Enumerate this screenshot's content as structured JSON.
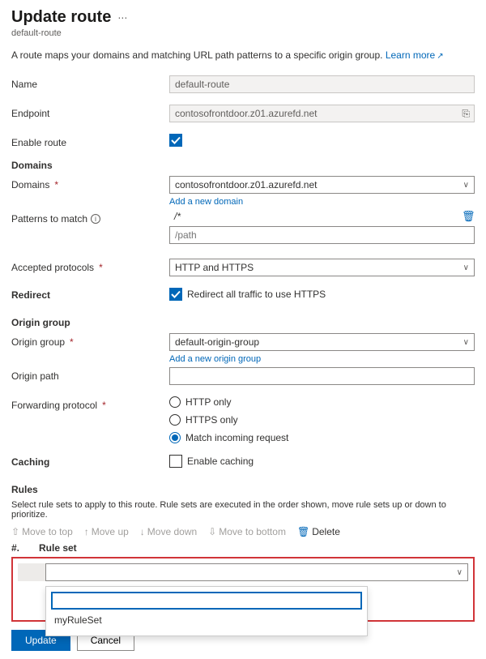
{
  "header": {
    "title": "Update route",
    "subtitle": "default-route",
    "description": "A route maps your domains and matching URL path patterns to a specific origin group.",
    "learn_more": "Learn more"
  },
  "fields": {
    "name": {
      "label": "Name",
      "value": "default-route"
    },
    "endpoint": {
      "label": "Endpoint",
      "value": "contosofrontdoor.z01.azurefd.net"
    },
    "enable_route": {
      "label": "Enable route",
      "checked": true
    }
  },
  "domains": {
    "section": "Domains",
    "domains_label": "Domains",
    "domains_value": "contosofrontdoor.z01.azurefd.net",
    "add_link": "Add a new domain",
    "patterns_label": "Patterns to match",
    "pattern_static": "/*",
    "pattern_input_placeholder": "/path",
    "accepted_label": "Accepted protocols",
    "accepted_value": "HTTP and HTTPS"
  },
  "redirect": {
    "section": "Redirect",
    "redirect_label": "Redirect all traffic to use HTTPS",
    "checked": true
  },
  "origin": {
    "section": "Origin group",
    "group_label": "Origin group",
    "group_value": "default-origin-group",
    "add_link": "Add a new origin group",
    "path_label": "Origin path",
    "path_value": "",
    "fwd_label": "Forwarding protocol",
    "fwd_options": [
      "HTTP only",
      "HTTPS only",
      "Match incoming request"
    ],
    "fwd_selected": 2
  },
  "caching": {
    "section": "Caching",
    "enable_label": "Enable caching",
    "checked": false
  },
  "rules": {
    "section": "Rules",
    "desc": "Select rule sets to apply to this route. Rule sets are executed in the order shown, move rule sets up or down to prioritize.",
    "toolbar": {
      "top": "Move to top",
      "up": "Move up",
      "down": "Move down",
      "bottom": "Move to bottom",
      "delete": "Delete"
    },
    "col_num": "#.",
    "col_ruleset": "Rule set",
    "dropdown_search": "",
    "option1": "myRuleSet"
  },
  "footer": {
    "update": "Update",
    "cancel": "Cancel"
  }
}
